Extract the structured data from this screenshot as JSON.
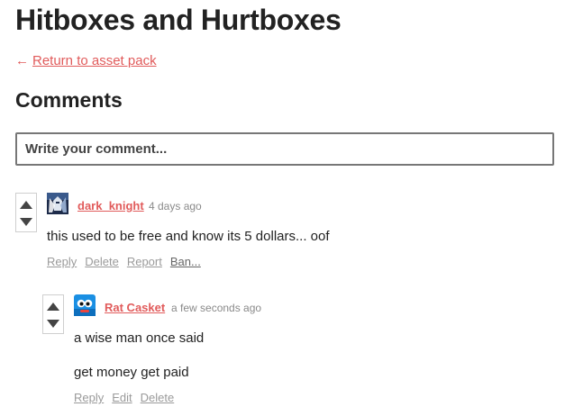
{
  "page": {
    "title": "Hitboxes and Hurtboxes",
    "back_arrow": "←",
    "back_link": "Return to asset pack"
  },
  "comments_section": {
    "heading": "Comments",
    "input_placeholder": "Write your comment..."
  },
  "comments": [
    {
      "author": "dark_knight",
      "time": "4 days ago",
      "text": "this used to be free and know its 5 dollars... oof",
      "actions": [
        "Reply",
        "Delete",
        "Report",
        "Ban..."
      ]
    },
    {
      "author": "Rat Casket",
      "time": "a few seconds ago",
      "text_lines": [
        "a wise man once said",
        "get money get paid"
      ],
      "actions": [
        "Reply",
        "Edit",
        "Delete"
      ]
    }
  ],
  "colors": {
    "accent": "#e15b5b",
    "muted": "#9a9a9a",
    "text": "#222222"
  }
}
